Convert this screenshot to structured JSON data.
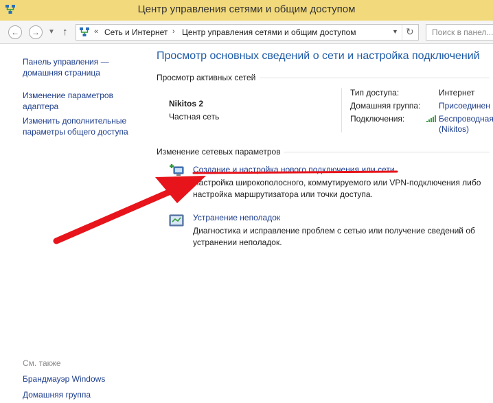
{
  "window": {
    "title": "Центр управления сетями и общим доступом"
  },
  "navigation": {
    "breadcrumbs": [
      "Сеть и Интернет",
      "Центр управления сетями и общим доступом"
    ],
    "breadcrumb_prefix": "«",
    "search_placeholder": "Поиск в панел..."
  },
  "sidebar": {
    "links": [
      "Панель управления — домашняя страница",
      "Изменение параметров адаптера",
      "Изменить дополнительные параметры общего доступа"
    ],
    "see_also_label": "См. также",
    "see_also": [
      "Брандмауэр Windows",
      "Домашняя группа"
    ]
  },
  "main": {
    "title": "Просмотр основных сведений о сети и настройка подключений",
    "active_networks_label": "Просмотр активных сетей",
    "network": {
      "name": "Nikitos  2",
      "type": "Частная сеть",
      "access_type_label": "Тип доступа:",
      "access_type": "Интернет",
      "homegroup_label": "Домашняя группа:",
      "homegroup": "Присоединен",
      "connections_label": "Подключения:",
      "connection_line1": "Беспроводная",
      "connection_line2": "(Nikitos)"
    },
    "change_settings_label": "Изменение сетевых параметров",
    "tasks": [
      {
        "icon": "network-setup-icon",
        "title": "Создание и настройка нового подключения или сети",
        "description": "Настройка широкополосного, коммутируемого или VPN-подключения либо настройка маршрутизатора или точки доступа."
      },
      {
        "icon": "troubleshoot-icon",
        "title": "Устранение неполадок",
        "description": "Диагностика и исправление проблем с сетью или получение сведений об устранении неполадок."
      }
    ]
  },
  "colors": {
    "titlebar": "#f1d97c",
    "link": "#1c3d8c",
    "heading": "#1d5aa6",
    "annotation": "#e8141b"
  }
}
